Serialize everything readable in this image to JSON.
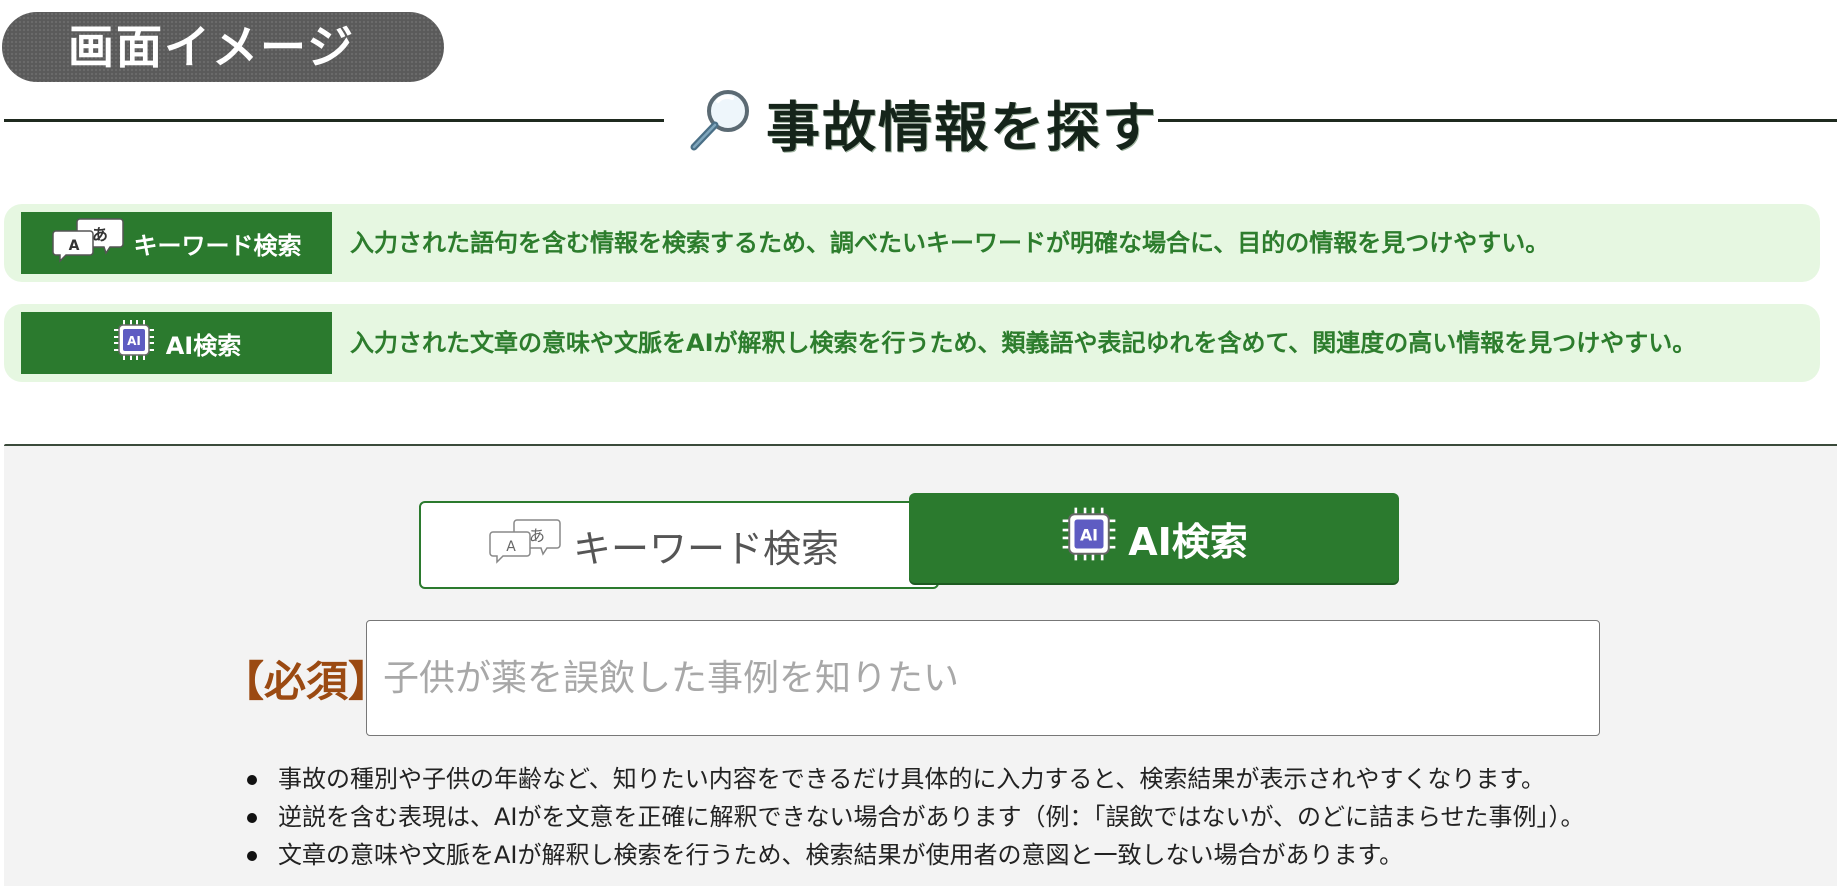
{
  "badge": {
    "label": "画面イメージ"
  },
  "title": {
    "text": "事故情報を探す",
    "icon": "magnifier-icon"
  },
  "info_rows": [
    {
      "label": "キーワード検索",
      "icon": "speech-bubbles-a-icon",
      "description": "入力された語句を含む情報を検索するため、調べたいキーワードが明確な場合に、目的の情報を見つけやすい。"
    },
    {
      "label": "AI検索",
      "icon": "ai-chip-icon",
      "description": "入力された文章の意味や文脈をAIが解釈し検索を行うため、類義語や表記ゆれを含めて、関連度の高い情報を見つけやすい。"
    }
  ],
  "tabs": {
    "keyword": {
      "label": "キーワード検索",
      "icon": "speech-bubbles-a-icon",
      "selected": false
    },
    "ai": {
      "label": "AI検索",
      "icon": "ai-chip-icon",
      "selected": true
    }
  },
  "form": {
    "required_label": "【必須】",
    "input_placeholder": "子供が薬を誤飲した事例を知りたい",
    "input_value": ""
  },
  "notes": [
    "事故の種別や子供の年齢など、知りたい内容をできるだけ具体的に入力すると、検索結果が表示されやすくなります。",
    "逆説を含む表現は、AIがを文意を正確に解釈できない場合があります（例：「誤飲ではないが、のどに詰まらせた事例」）。",
    "文章の意味や文脈をAIが解釈し検索を行うため、検索結果が使用者の意図と一致しない場合があります。"
  ],
  "colors": {
    "primary_green": "#2b7a2e",
    "info_bg": "#e6f7e1",
    "info_text": "#2d7d2d",
    "required": "#9b4a12",
    "panel_bg": "#f3f3f3",
    "badge_bg": "#5a5a5a"
  }
}
